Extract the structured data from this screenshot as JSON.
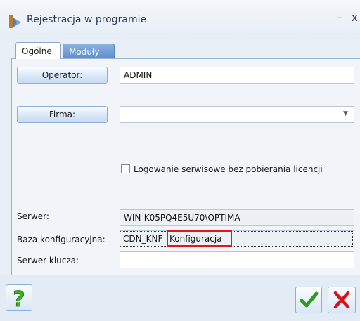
{
  "window": {
    "title": "Rejestracja w programie",
    "minimize_glyph": "–",
    "close_glyph": "x"
  },
  "tabs": [
    {
      "label": "Ogólne",
      "active": true
    },
    {
      "label": "Moduły",
      "active": false
    }
  ],
  "form": {
    "operator_button": "Operator:",
    "operator_value": "ADMIN",
    "firma_button": "Firma:",
    "firma_value": "",
    "checkbox_label": "Logowanie serwisowe bez pobierania licencji",
    "checkbox_checked": false,
    "serwer_label": "Serwer:",
    "serwer_value": "WIN-K05PQ4E5U70\\OPTIMA",
    "baza_label": "Baza konfiguracyjna:",
    "baza_value_prefix": "CDN_KNF",
    "baza_value_highlight": "Konfiguracja",
    "serwer_klucza_label": "Serwer klucza:",
    "serwer_klucza_value": ""
  },
  "icons": {
    "help": "question-mark-icon",
    "confirm": "checkmark-icon",
    "cancel": "cross-icon",
    "app": "app-logo-icon"
  },
  "colors": {
    "highlight_border": "#e01818",
    "confirm_green": "#2e9a1f",
    "cancel_red": "#d8121b",
    "help_green": "#3bb21c"
  }
}
